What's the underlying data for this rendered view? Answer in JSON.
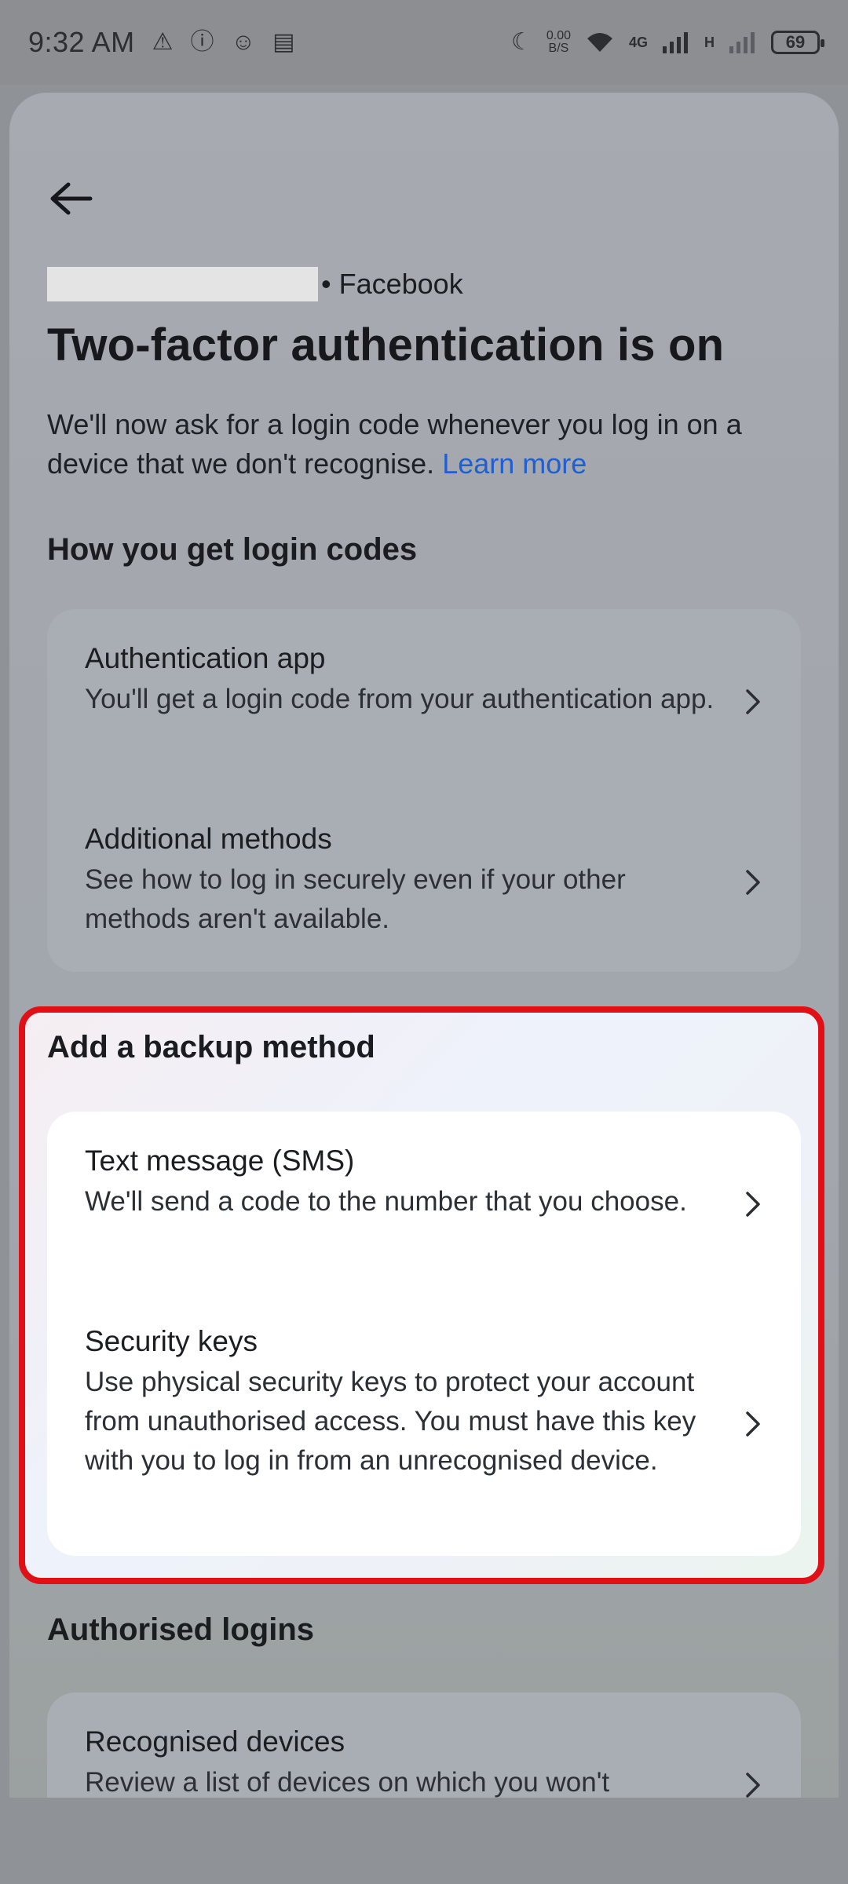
{
  "status_bar": {
    "time": "9:32 AM",
    "net_speed": "0.00",
    "net_unit": "B/S",
    "net_type": "4G",
    "net_type2": "H",
    "battery": "69"
  },
  "header": {
    "account_suffix": "• Facebook",
    "title": "Two-factor authentication is on",
    "description": "We'll now ask for a login code whenever you log in on a device that we don't recognise.",
    "learn_more": "Learn more"
  },
  "login_codes": {
    "section_title": "How you get login codes",
    "items": [
      {
        "title": "Authentication app",
        "desc": "You'll get a login code from your authentication app."
      },
      {
        "title": "Additional methods",
        "desc": "See how to log in securely even if your other methods aren't available."
      }
    ]
  },
  "backup": {
    "section_title": "Add a backup method",
    "items": [
      {
        "title": "Text message (SMS)",
        "desc": "We'll send a code to the number that you choose."
      },
      {
        "title": "Security keys",
        "desc": "Use physical security keys to protect your account from unauthorised access. You must have this key with you to log in from an unrecognised device."
      }
    ]
  },
  "authorised": {
    "section_title": "Authorised logins",
    "items": [
      {
        "title": "Recognised devices",
        "desc": "Review a list of devices on which you won't"
      }
    ]
  }
}
